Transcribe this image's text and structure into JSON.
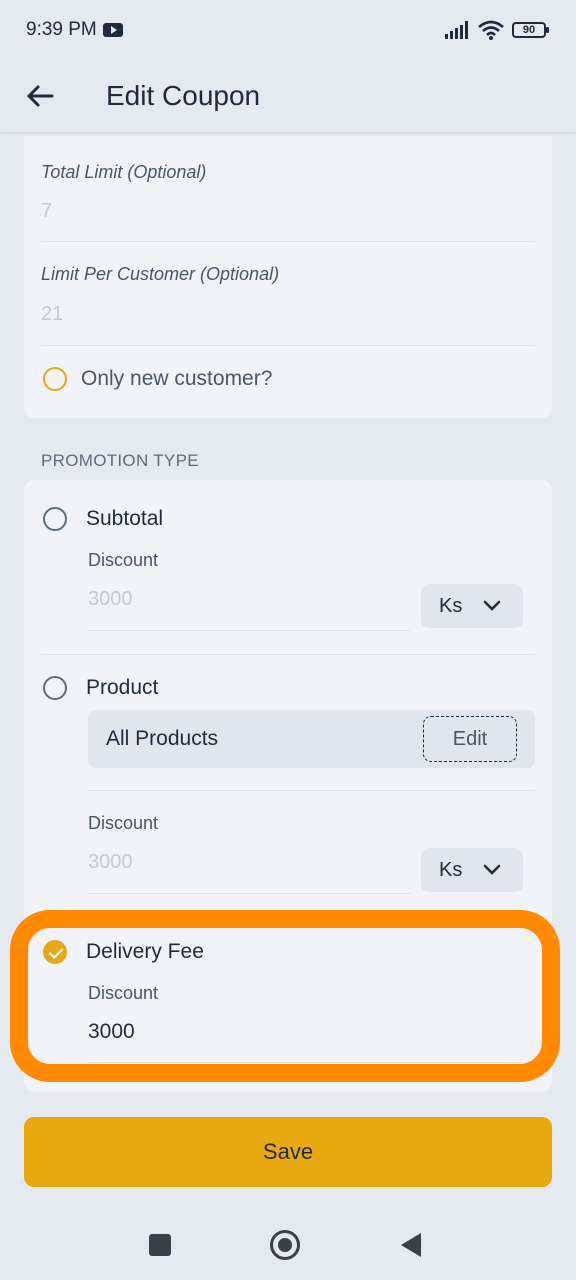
{
  "status_bar": {
    "time": "9:39 PM",
    "battery": "90"
  },
  "app_bar": {
    "title": "Edit Coupon"
  },
  "limits": {
    "total_limit_label": "Total Limit (Optional)",
    "total_limit_value": "7",
    "per_customer_label": "Limit Per Customer (Optional)",
    "per_customer_value": "21",
    "new_customer_label": "Only new customer?"
  },
  "promotion": {
    "section_label": "PROMOTION TYPE",
    "subtotal": {
      "label": "Subtotal",
      "discount_label": "Discount",
      "discount_placeholder": "3000",
      "currency": "Ks"
    },
    "product": {
      "label": "Product",
      "products_value": "All Products",
      "edit_label": "Edit",
      "discount_label": "Discount",
      "discount_placeholder": "3000",
      "currency": "Ks"
    },
    "delivery_fee": {
      "label": "Delivery Fee",
      "discount_label": "Discount",
      "discount_value": "3000",
      "selected": true
    }
  },
  "save_label": "Save",
  "colors": {
    "accent": "#e8aa10",
    "highlight": "#ff8a00",
    "background": "#e5e9f0",
    "card": "#f1f3f8"
  }
}
